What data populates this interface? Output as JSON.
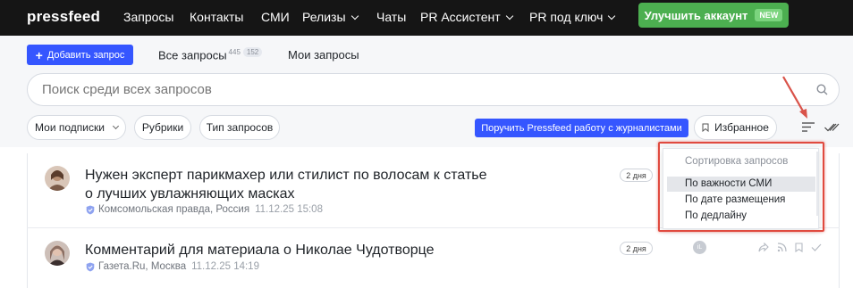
{
  "nav": {
    "logo": "pressfeed",
    "items": [
      {
        "label": "Запросы",
        "active": true
      },
      {
        "label": "Контакты"
      },
      {
        "label": "СМИ"
      },
      {
        "label": "Релизы",
        "dropdown": true
      },
      {
        "label": "Чаты"
      },
      {
        "label": "PR Ассистент",
        "dropdown": true
      },
      {
        "label": "PR под ключ",
        "dropdown": true
      }
    ],
    "upgrade_label": "Улучшить аккаунт",
    "new_badge": "NEW"
  },
  "toolbar": {
    "add_label": "Добавить запрос",
    "tab_all": "Все запросы",
    "tab_all_count": "445",
    "tab_all_new": "152",
    "tab_mine": "Мои запросы"
  },
  "search": {
    "placeholder": "Поиск среди всех запросов"
  },
  "filters": {
    "subscriptions": "Мои подписки",
    "rubrics": "Рубрики",
    "types": "Тип запросов",
    "journalists_btn": "Поручить Pressfeed работу с журналистами",
    "favorites": "Избранное"
  },
  "requests": [
    {
      "title": "Нужен эксперт парикмахер или стилист по волосам к статье о лучших увлажняющих масках",
      "outlet": "Комсомольская правда, Россия",
      "date": "11.12.25 15:08",
      "days": "2 дня"
    },
    {
      "title": "Комментарий для материала о Николае Чудотворце",
      "outlet": "Газета.Ru, Москва",
      "date": "11.12.25 14:19",
      "days": "2 дня"
    }
  ],
  "row_actions": {
    "mini_avatar": "iL"
  },
  "sort_dropdown": {
    "header": "Сортировка запросов",
    "options": [
      {
        "label": "По важности СМИ",
        "selected": true
      },
      {
        "label": "По дате размещения"
      },
      {
        "label": "По дедлайну"
      }
    ]
  },
  "colors": {
    "nav_bg": "#151515",
    "accent": "#3556ff",
    "upgrade": "#4caf50",
    "highlight": "#e04a3f"
  }
}
